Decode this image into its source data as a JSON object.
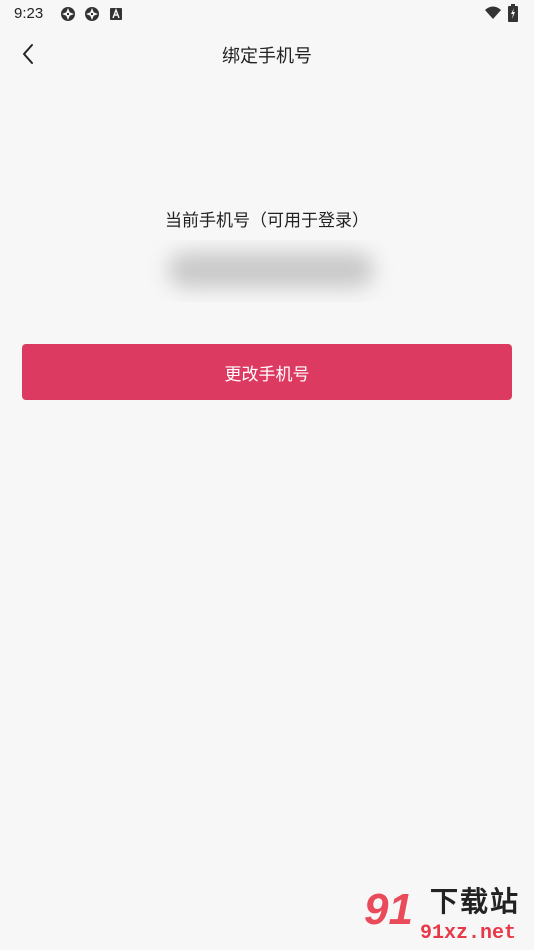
{
  "status_bar": {
    "time": "9:23",
    "icons": [
      "aperture-icon",
      "aperture-icon",
      "font-a-icon",
      "wifi-icon",
      "battery-charging-icon"
    ]
  },
  "navbar": {
    "title": "绑定手机号",
    "back_icon": "chevron-left-icon"
  },
  "main": {
    "phone_label": "当前手机号（可用于登录）",
    "change_button_label": "更改手机号"
  },
  "watermark": {
    "number": "91",
    "site_name": "下载站",
    "url": "91xz.net"
  },
  "colors": {
    "background": "#f7f7f7",
    "accent": "#dd3a61"
  }
}
